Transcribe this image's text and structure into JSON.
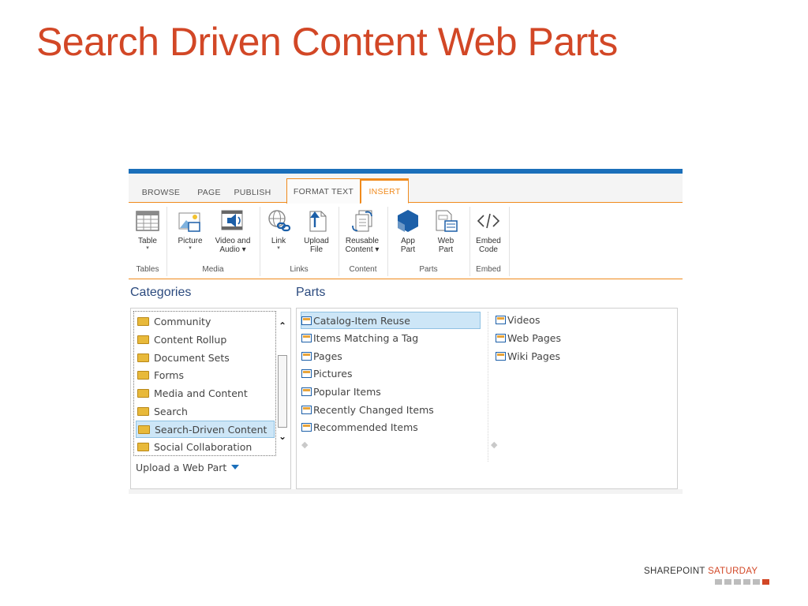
{
  "slide": {
    "title": "Search Driven Content Web Parts"
  },
  "tabs": [
    "BROWSE",
    "PAGE",
    "PUBLISH",
    "FORMAT TEXT",
    "INSERT"
  ],
  "ribbon": {
    "buttons": [
      {
        "line1": "Table",
        "line2": "",
        "arrow": "▾",
        "icon": "table-icon"
      },
      {
        "line1": "Picture",
        "line2": "",
        "arrow": "▾",
        "icon": "picture-icon"
      },
      {
        "line1": "Video and",
        "line2": "Audio ▾",
        "arrow": "",
        "icon": "video-audio-icon"
      },
      {
        "line1": "Link",
        "line2": "",
        "arrow": "▾",
        "icon": "link-icon"
      },
      {
        "line1": "Upload",
        "line2": "File",
        "arrow": "",
        "icon": "upload-file-icon"
      },
      {
        "line1": "Reusable",
        "line2": "Content ▾",
        "arrow": "",
        "icon": "reusable-content-icon"
      },
      {
        "line1": "App",
        "line2": "Part",
        "arrow": "",
        "icon": "app-part-icon"
      },
      {
        "line1": "Web",
        "line2": "Part",
        "arrow": "",
        "icon": "web-part-icon"
      },
      {
        "line1": "Embed",
        "line2": "Code",
        "arrow": "",
        "icon": "embed-code-icon"
      }
    ],
    "groups": [
      "Tables",
      "Media",
      "Links",
      "Content",
      "Parts",
      "Embed"
    ]
  },
  "categories": {
    "heading": "Categories",
    "items": [
      "Community",
      "Content Rollup",
      "Document Sets",
      "Forms",
      "Media and Content",
      "Search",
      "Search-Driven Content",
      "Social Collaboration"
    ],
    "selected": "Search-Driven Content",
    "upload_label": "Upload a Web Part"
  },
  "parts": {
    "heading": "Parts",
    "column1": [
      "Catalog-Item Reuse",
      "Items Matching a Tag",
      "Pages",
      "Pictures",
      "Popular Items",
      "Recently Changed Items",
      "Recommended Items"
    ],
    "column2": [
      "Videos",
      "Web Pages",
      "Wiki Pages"
    ],
    "selected": "Catalog-Item Reuse"
  },
  "footer": {
    "brand_part1": "SHAREPOINT ",
    "brand_part2": "SATURDAY"
  },
  "colors": {
    "accent_orange": "#f08a1c",
    "title_red": "#d24726",
    "top_blue": "#1b6fba",
    "selection": "#cde6f7"
  }
}
